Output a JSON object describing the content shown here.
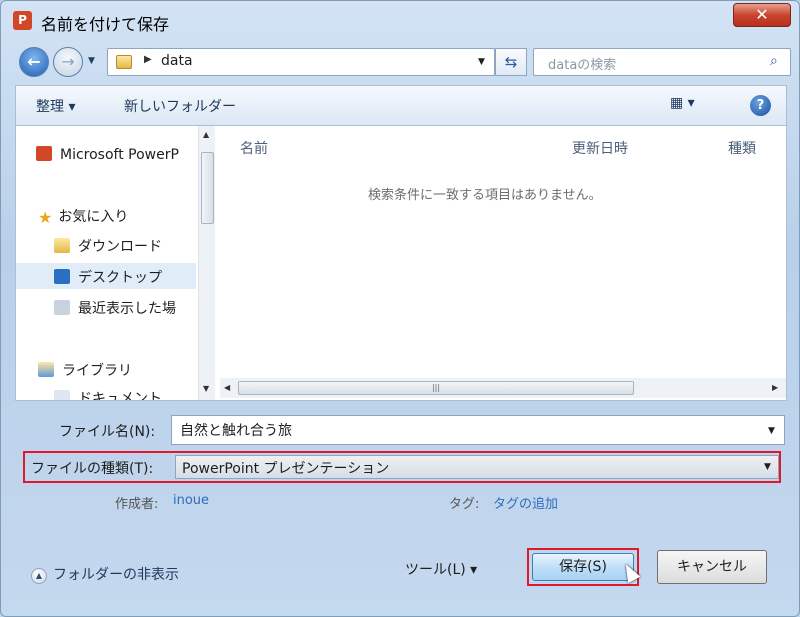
{
  "window": {
    "title": "名前を付けて保存",
    "app_icon_letter": "P",
    "close_glyph": "✕"
  },
  "address": {
    "crumb": "data",
    "search_placeholder": "dataの検索"
  },
  "toolbar": {
    "organize": "整理 ▾",
    "new_folder": "新しいフォルダー",
    "view": "▦ ▾",
    "help": "?"
  },
  "nav": {
    "items": [
      {
        "label": "Microsoft PowerP",
        "icon": "powerpoint-icon"
      },
      {
        "label": "お気に入り",
        "icon": "star-icon"
      },
      {
        "label": "ダウンロード",
        "icon": "downloads-icon"
      },
      {
        "label": "デスクトップ",
        "icon": "desktop-icon"
      },
      {
        "label": "最近表示した場",
        "icon": "recent-places-icon"
      },
      {
        "label": "ライブラリ",
        "icon": "libraries-icon"
      },
      {
        "label": "ドキュメント",
        "icon": "documents-icon"
      }
    ],
    "selected": "デスクトップ"
  },
  "filelist": {
    "columns": [
      "名前",
      "更新日時",
      "種類"
    ],
    "empty_message": "検索条件に一致する項目はありません。"
  },
  "form": {
    "filename_label": "ファイル名(N):",
    "filename_value": "自然と触れ合う旅",
    "filetype_label": "ファイルの種類(T):",
    "filetype_value": "PowerPoint プレゼンテーション",
    "author_label": "作成者:",
    "author_value": "inoue",
    "tag_label": "タグ:",
    "tag_value": "タグの追加"
  },
  "footer": {
    "hide_folders": "フォルダーの非表示",
    "tools": "ツール(L)  ▾",
    "save": "保存(S)",
    "cancel": "キャンセル"
  },
  "colors": {
    "highlight": "#e0182c",
    "link": "#2e6bbf"
  }
}
